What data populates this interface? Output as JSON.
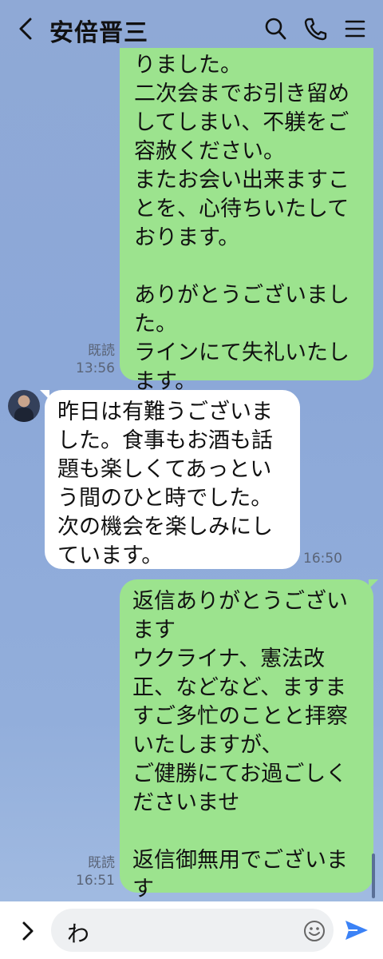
{
  "header": {
    "title": "安倍晋三",
    "back_icon": "chevron-left-icon",
    "search_icon": "search-icon",
    "call_icon": "phone-icon",
    "menu_icon": "menu-icon"
  },
  "messages": [
    {
      "side": "sent",
      "text": "りました。\n二次会までお引き留め\nしてしまい、不躾をご\n容赦ください。\nまたお会い出来ますこ\nとを、心待ちいたして\nおります。\n\nありがとうございまし\nた。\nラインにて失礼いたし\nます。",
      "read": "既読",
      "time": "13:56"
    },
    {
      "side": "received",
      "text": "昨日は有難うございま\nした。食事もお酒も話\n題も楽しくてあっとい\nう間のひと時でした。\n次の機会を楽しみにし\nています。",
      "time": "16:50"
    },
    {
      "side": "sent",
      "text": "返信ありがとうござい\nます\nウクライナ、憲法改\n正、などなど、ますま\nすご多忙のことと拝察\nいたしますが、\nご健勝にてお過ごしく\nださいませ\n\n返信御無用でございま\nす",
      "read": "既読",
      "time": "16:51"
    }
  ],
  "input": {
    "value": "わ",
    "expand_icon": "chevron-right-icon",
    "emoji_icon": "emoji-icon",
    "send_icon": "send-icon"
  },
  "colors": {
    "sent_bubble": "#9ce38e",
    "received_bubble": "#ffffff",
    "background": "#8ca8d8",
    "send_accent": "#3b82f6"
  }
}
